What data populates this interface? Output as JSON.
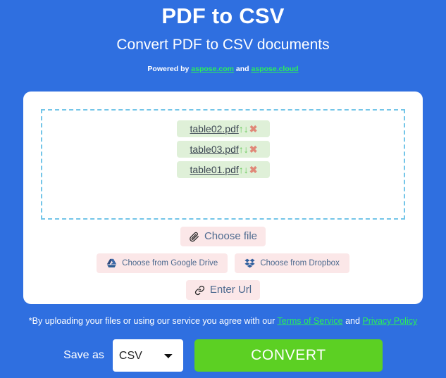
{
  "header": {
    "title": "PDF to CSV",
    "subtitle": "Convert PDF to CSV documents",
    "powered_prefix": "Powered by ",
    "powered_link1": "aspose.com",
    "powered_and": " and ",
    "powered_link2": "aspose.cloud"
  },
  "dropzone": {
    "files": [
      {
        "name": "table02.pdf",
        "move_up": "↑",
        "move_down": "↓",
        "remove": "✖"
      },
      {
        "name": "table03.pdf",
        "move_up": "↑",
        "move_down": "↓",
        "remove": "✖"
      },
      {
        "name": "table01.pdf",
        "move_up": "↑",
        "move_down": "↓",
        "remove": "✖"
      }
    ]
  },
  "sources": {
    "choose_file": "Choose file",
    "google_drive": "Choose from Google Drive",
    "dropbox": "Choose from Dropbox",
    "enter_url": "Enter Url",
    "icons": {
      "choose_file": "paperclip-icon",
      "google_drive": "google-drive-icon",
      "dropbox": "dropbox-icon",
      "enter_url": "link-icon"
    }
  },
  "terms": {
    "text_before": "*By uploading your files or using our service you agree with our ",
    "link1": "Terms of Service",
    "text_between": " and ",
    "link2": "Privacy Policy"
  },
  "footer": {
    "save_as_label": "Save as",
    "format_selected": "CSV",
    "format_options": [
      "CSV"
    ],
    "convert_label": "CONVERT"
  },
  "colors": {
    "page_background": "#2f6fe0",
    "card_background": "#ffffff",
    "dropzone_border": "#73c5e8",
    "file_item_background": "#dff0d8",
    "arrow_green": "#68c95b",
    "remove_red": "#e08878",
    "source_button_background": "#fbe7e8",
    "source_button_text": "#4d6a8f",
    "link_green": "#2aee5a",
    "convert_green": "#5cd023"
  }
}
